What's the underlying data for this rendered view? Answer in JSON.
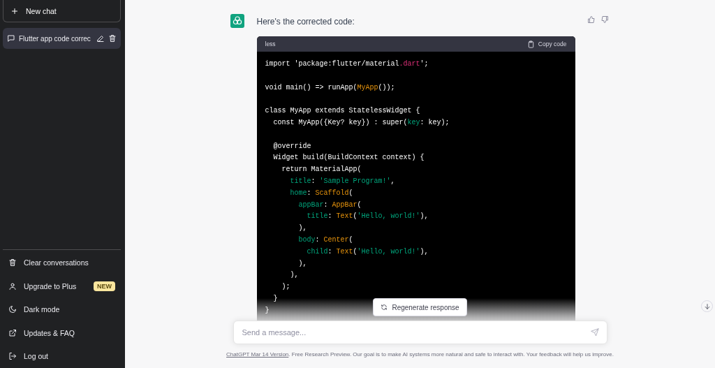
{
  "sidebar": {
    "new_chat": {
      "label": "New chat"
    },
    "conversations": [
      {
        "title": "Flutter app code correc",
        "selected": true
      }
    ],
    "menu": [
      {
        "kind": "trash",
        "label": "Clear conversations"
      },
      {
        "kind": "user",
        "label": "Upgrade to Plus",
        "badge": "NEW"
      },
      {
        "kind": "moon",
        "label": "Dark mode"
      },
      {
        "kind": "external",
        "label": "Updates & FAQ"
      },
      {
        "kind": "logout",
        "label": "Log out"
      }
    ]
  },
  "message": {
    "text": "Here's the corrected code:",
    "code": {
      "language": "less",
      "copy_label": "Copy code",
      "lines": [
        {
          "kind": "code",
          "tokens": [
            {
              "kind": "plain",
              "text": "import 'package:flutter/material"
            },
            {
              "kind": "keyword",
              "text": ".dart"
            },
            {
              "kind": "plain",
              "text": "';"
            }
          ]
        },
        {
          "kind": "blank"
        },
        {
          "kind": "code",
          "tokens": [
            {
              "kind": "plain",
              "text": "void main() => runApp("
            },
            {
              "kind": "type",
              "text": "MyApp"
            },
            {
              "kind": "plain",
              "text": "());"
            }
          ]
        },
        {
          "kind": "blank"
        },
        {
          "kind": "code",
          "tokens": [
            {
              "kind": "plain",
              "text": "class MyApp extends StatelessWidget {"
            }
          ]
        },
        {
          "kind": "code",
          "tokens": [
            {
              "kind": "plain",
              "text": "  const MyApp({Key? key}) : super("
            },
            {
              "kind": "attr",
              "text": "key"
            },
            {
              "kind": "plain",
              "text": ": key);"
            }
          ]
        },
        {
          "kind": "blank"
        },
        {
          "kind": "code",
          "tokens": [
            {
              "kind": "plain",
              "text": "  @override"
            }
          ]
        },
        {
          "kind": "code",
          "tokens": [
            {
              "kind": "plain",
              "text": "  Widget build(BuildContext context) {"
            }
          ]
        },
        {
          "kind": "code",
          "tokens": [
            {
              "kind": "plain",
              "text": "    return MaterialApp("
            }
          ]
        },
        {
          "kind": "code",
          "tokens": [
            {
              "kind": "attr",
              "text": "      title"
            },
            {
              "kind": "plain",
              "text": ": "
            },
            {
              "kind": "string",
              "text": "'Sample Program!'"
            },
            {
              "kind": "plain",
              "text": ","
            }
          ]
        },
        {
          "kind": "code",
          "tokens": [
            {
              "kind": "attr",
              "text": "      home"
            },
            {
              "kind": "plain",
              "text": ": "
            },
            {
              "kind": "type",
              "text": "Scaffold"
            },
            {
              "kind": "plain",
              "text": "("
            }
          ]
        },
        {
          "kind": "code",
          "tokens": [
            {
              "kind": "attr",
              "text": "        appBar"
            },
            {
              "kind": "plain",
              "text": ": "
            },
            {
              "kind": "type",
              "text": "AppBar"
            },
            {
              "kind": "plain",
              "text": "("
            }
          ]
        },
        {
          "kind": "code",
          "tokens": [
            {
              "kind": "attr",
              "text": "          title"
            },
            {
              "kind": "plain",
              "text": ": "
            },
            {
              "kind": "type",
              "text": "Text"
            },
            {
              "kind": "plain",
              "text": "("
            },
            {
              "kind": "string",
              "text": "'Hello, world!'"
            },
            {
              "kind": "plain",
              "text": "),"
            }
          ]
        },
        {
          "kind": "code",
          "tokens": [
            {
              "kind": "plain",
              "text": "        ),"
            }
          ]
        },
        {
          "kind": "code",
          "tokens": [
            {
              "kind": "attr",
              "text": "        body"
            },
            {
              "kind": "plain",
              "text": ": "
            },
            {
              "kind": "type",
              "text": "Center"
            },
            {
              "kind": "plain",
              "text": "("
            }
          ]
        },
        {
          "kind": "code",
          "tokens": [
            {
              "kind": "attr",
              "text": "          child"
            },
            {
              "kind": "plain",
              "text": ": "
            },
            {
              "kind": "type",
              "text": "Text"
            },
            {
              "kind": "plain",
              "text": "("
            },
            {
              "kind": "string",
              "text": "'Hello, world!'"
            },
            {
              "kind": "plain",
              "text": "),"
            }
          ]
        },
        {
          "kind": "code",
          "tokens": [
            {
              "kind": "plain",
              "text": "        ),"
            }
          ]
        },
        {
          "kind": "code",
          "tokens": [
            {
              "kind": "plain",
              "text": "      ),"
            }
          ]
        },
        {
          "kind": "code",
          "tokens": [
            {
              "kind": "plain",
              "text": "    );"
            }
          ]
        },
        {
          "kind": "code",
          "tokens": [
            {
              "kind": "plain",
              "text": "  }"
            }
          ]
        },
        {
          "kind": "code",
          "tokens": [
            {
              "kind": "plain",
              "text": "}"
            }
          ]
        }
      ]
    }
  },
  "regenerate": {
    "label": "Regenerate response"
  },
  "input": {
    "placeholder": "Send a message..."
  },
  "footer": {
    "link": "ChatGPT Mar 14 Version",
    "text": ". Free Research Preview. Our goal is to make AI systems more natural and safe to interact with. Your feedback will help us improve."
  }
}
